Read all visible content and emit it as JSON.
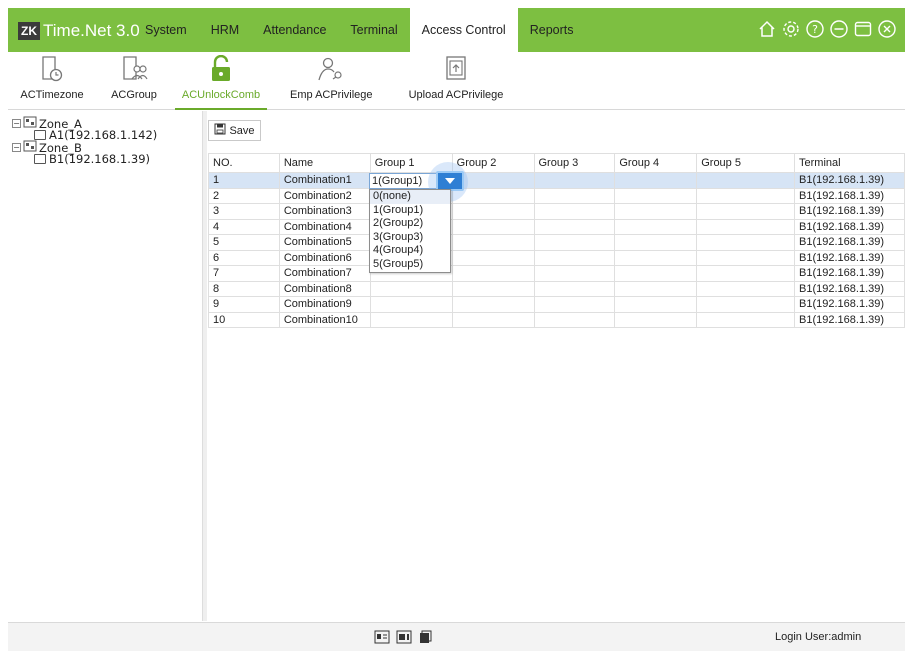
{
  "app": {
    "logo_badge": "ZK",
    "title": "Time.Net 3.0"
  },
  "menu": [
    {
      "label": "System",
      "active": false
    },
    {
      "label": "HRM",
      "active": false
    },
    {
      "label": "Attendance",
      "active": false
    },
    {
      "label": "Terminal",
      "active": false
    },
    {
      "label": "Access Control",
      "active": true
    },
    {
      "label": "Reports",
      "active": false
    }
  ],
  "window_icons": [
    "home-icon",
    "settings-icon",
    "help-icon",
    "minimize-icon",
    "maximize-icon",
    "close-icon"
  ],
  "toolbar": [
    {
      "label": "ACTimezone",
      "icon": "timezone-doc-icon"
    },
    {
      "label": "ACGroup",
      "icon": "group-doc-icon"
    },
    {
      "label": "ACUnlockComb",
      "icon": "unlock-icon",
      "active": true
    },
    {
      "label": "Emp ACPrivilege",
      "icon": "privilege-icon"
    },
    {
      "label": "Upload ACPrivilege",
      "icon": "upload-icon"
    }
  ],
  "tree": [
    {
      "label": "Zone_A",
      "type": "zone"
    },
    {
      "label": "A1(192.168.1.142)",
      "type": "device"
    },
    {
      "label": "Zone_B",
      "type": "zone"
    },
    {
      "label": "B1(192.168.1.39)",
      "type": "device"
    }
  ],
  "save_label": "Save",
  "table": {
    "columns": [
      "NO.",
      "Name",
      "Group 1",
      "Group 2",
      "Group 3",
      "Group 4",
      "Group 5",
      "Terminal"
    ],
    "rows": [
      [
        "1",
        "Combination1",
        "1(Group1)",
        "",
        "",
        "",
        "",
        "B1(192.168.1.39)"
      ],
      [
        "2",
        "Combination2",
        "",
        "",
        "",
        "",
        "",
        "B1(192.168.1.39)"
      ],
      [
        "3",
        "Combination3",
        "",
        "",
        "",
        "",
        "",
        "B1(192.168.1.39)"
      ],
      [
        "4",
        "Combination4",
        "",
        "",
        "",
        "",
        "",
        "B1(192.168.1.39)"
      ],
      [
        "5",
        "Combination5",
        "",
        "",
        "",
        "",
        "",
        "B1(192.168.1.39)"
      ],
      [
        "6",
        "Combination6",
        "",
        "",
        "",
        "",
        "",
        "B1(192.168.1.39)"
      ],
      [
        "7",
        "Combination7",
        "",
        "",
        "",
        "",
        "",
        "B1(192.168.1.39)"
      ],
      [
        "8",
        "Combination8",
        "",
        "",
        "",
        "",
        "",
        "B1(192.168.1.39)"
      ],
      [
        "9",
        "Combination9",
        "",
        "",
        "",
        "",
        "",
        "B1(192.168.1.39)"
      ],
      [
        "10",
        "Combination10",
        "",
        "",
        "",
        "",
        "",
        "B1(192.168.1.39)"
      ]
    ]
  },
  "combo": {
    "value": "1(Group1)",
    "options": [
      "0(none)",
      "1(Group1)",
      "2(Group2)",
      "3(Group3)",
      "4(Group4)",
      "5(Group5)"
    ]
  },
  "status": {
    "login": "Login User:admin"
  },
  "colors": {
    "accent": "#7dbf41",
    "active_text": "#6aaa2a",
    "selection": "#d6e4f5",
    "combo_button": "#2f7fd4"
  }
}
